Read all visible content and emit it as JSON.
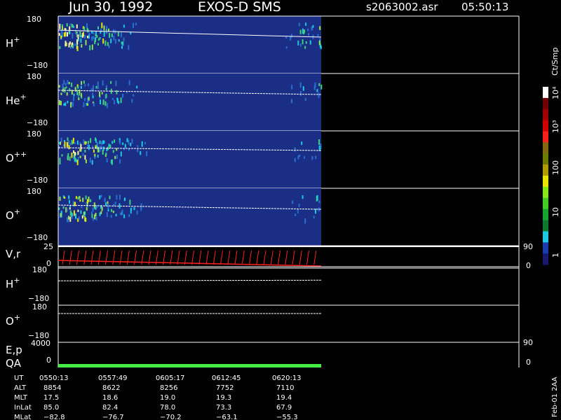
{
  "header": {
    "date": "Jun 30, 1992",
    "instrument": "EXOS-D SMS",
    "filename": "s2063002.asr",
    "time": "05:50:13"
  },
  "colors": {
    "background": "#000000",
    "panel_fill": "#1a2e86",
    "trace": "#ffffff",
    "velocity": "#ff2020",
    "qa": "#44ee44"
  },
  "chart_data": {
    "type": "heatmap",
    "panels": [
      {
        "label": "H",
        "sup": "+",
        "ylim": [
          -180,
          180
        ],
        "tick_top": "180",
        "tick_bottom": "−180",
        "intensity_profile": [
          5,
          6,
          6,
          6,
          5,
          5,
          4,
          4,
          4,
          4,
          3,
          2,
          2,
          1,
          1,
          0,
          0,
          0,
          0,
          0,
          0,
          0,
          0,
          0,
          0,
          0,
          0,
          0,
          0,
          0,
          0,
          0,
          0,
          0,
          0,
          0,
          0,
          0,
          0,
          0,
          0,
          0,
          0,
          1,
          1,
          2,
          3,
          2,
          2,
          3
        ],
        "trace_start": 20,
        "trace_end": 30
      },
      {
        "label": "He",
        "sup": "+",
        "ylim": [
          -180,
          180
        ],
        "tick_top": "180",
        "tick_bottom": "−180",
        "intensity_profile": [
          4,
          4,
          4,
          4,
          4,
          3,
          3,
          3,
          3,
          3,
          2,
          2,
          1,
          1,
          1,
          0,
          0,
          0,
          0,
          0,
          0,
          0,
          0,
          0,
          0,
          0,
          0,
          0,
          0,
          0,
          0,
          0,
          0,
          0,
          0,
          0,
          0,
          0,
          0,
          0,
          0,
          0,
          0,
          0,
          1,
          1,
          1,
          0,
          1,
          2
        ],
        "trace_start": 24,
        "trace_end": 30
      },
      {
        "label": "O",
        "sup": "++",
        "ylim": [
          -180,
          180
        ],
        "tick_top": "180",
        "tick_bottom": "−180",
        "intensity_profile": [
          4,
          5,
          5,
          5,
          5,
          4,
          4,
          4,
          4,
          3,
          3,
          3,
          2,
          2,
          1,
          1,
          1,
          0,
          0,
          0,
          0,
          0,
          0,
          0,
          0,
          0,
          0,
          0,
          0,
          0,
          0,
          0,
          0,
          0,
          0,
          0,
          0,
          0,
          0,
          0,
          0,
          0,
          0,
          0,
          1,
          1,
          1,
          0,
          1,
          2
        ],
        "trace_start": 24,
        "trace_end": 28
      },
      {
        "label": "O",
        "sup": "+",
        "ylim": [
          -180,
          180
        ],
        "tick_top": "180",
        "tick_bottom": "−180",
        "intensity_profile": [
          4,
          4,
          5,
          5,
          5,
          4,
          4,
          3,
          3,
          3,
          3,
          2,
          2,
          2,
          1,
          1,
          0,
          0,
          0,
          0,
          0,
          0,
          0,
          0,
          0,
          0,
          0,
          0,
          0,
          0,
          0,
          0,
          0,
          0,
          0,
          0,
          0,
          0,
          0,
          0,
          0,
          0,
          0,
          0,
          1,
          1,
          1,
          0,
          1,
          2
        ],
        "trace_start": 24,
        "trace_end": 30
      }
    ],
    "velocity_panel": {
      "label": "V,r",
      "left_ticks": [
        "25",
        "0"
      ],
      "right_ticks": [
        "90",
        "0"
      ],
      "n_spikes": 36
    },
    "line_panels": [
      {
        "label": "H",
        "sup": "+",
        "tick_top": "180",
        "tick_bottom": "−180",
        "trace_start": 40,
        "trace_end": 38
      },
      {
        "label": "O",
        "sup": "+",
        "tick_top": "180",
        "tick_bottom": "−180",
        "trace_start": 26,
        "trace_end": 26
      }
    ],
    "ep_panel": {
      "label": "E,p",
      "qa_label": "QA",
      "left_ticks": [
        "4000",
        "0"
      ],
      "right_ticks": [
        "90",
        "0"
      ]
    },
    "colorbar": {
      "unit": "Ct/Smp",
      "labels": [
        "10⁴",
        "10³",
        "100",
        "10",
        "1"
      ],
      "levels": [
        "#191970",
        "#1a3dab",
        "#1ec8e0",
        "#0e7a2e",
        "#16a332",
        "#44cc22",
        "#88e818",
        "#e6e600",
        "#b09c00",
        "#6e7a00",
        "#806a10",
        "#ff1e1e",
        "#d00000",
        "#a00000",
        "#700000",
        "#ffffff"
      ]
    },
    "footer": {
      "rows": [
        {
          "name": "UT",
          "values": [
            "0550:13",
            "0557:49",
            "0605:17",
            "0612:45",
            "0620:13"
          ]
        },
        {
          "name": "ALT",
          "values": [
            "8854",
            "8622",
            "8256",
            "7752",
            "7110"
          ]
        },
        {
          "name": "MLT",
          "values": [
            "17.5",
            "18.6",
            "19.0",
            "19.3",
            "19.4"
          ]
        },
        {
          "name": "InLat",
          "values": [
            "85.0",
            "82.4",
            "78.0",
            "73.3",
            "67.9"
          ]
        },
        {
          "name": "MLat",
          "values": [
            "−82.8",
            "−76.7",
            "−70.2",
            "−63.1",
            "−55.3"
          ]
        }
      ]
    },
    "side_label": "Feb-01 2AA"
  }
}
